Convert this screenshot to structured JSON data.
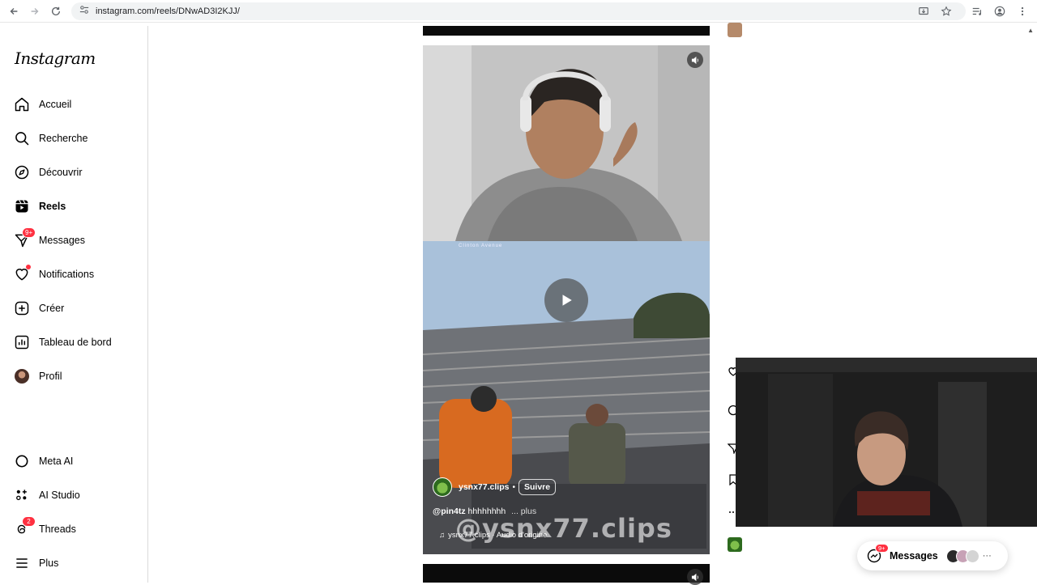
{
  "browser": {
    "url": "instagram.com/reels/DNwAD3I2KJJ/"
  },
  "sidebar": {
    "logo": "Instagram",
    "items": [
      {
        "label": "Accueil",
        "icon": "home-icon"
      },
      {
        "label": "Recherche",
        "icon": "search-icon"
      },
      {
        "label": "Découvrir",
        "icon": "compass-icon"
      },
      {
        "label": "Reels",
        "icon": "reels-icon",
        "active": true
      },
      {
        "label": "Messages",
        "icon": "messenger-icon",
        "badge": "9+"
      },
      {
        "label": "Notifications",
        "icon": "heart-icon",
        "dot": true
      },
      {
        "label": "Créer",
        "icon": "plus-square-icon"
      },
      {
        "label": "Tableau de bord",
        "icon": "dashboard-icon"
      },
      {
        "label": "Profil",
        "icon": "avatar"
      }
    ],
    "bottom_items": [
      {
        "label": "Meta AI",
        "icon": "meta-ai-icon"
      },
      {
        "label": "AI Studio",
        "icon": "ai-studio-icon"
      },
      {
        "label": "Threads",
        "icon": "threads-icon",
        "badge": "2"
      },
      {
        "label": "Plus",
        "icon": "menu-icon"
      }
    ]
  },
  "reel": {
    "top_text": "Clinton Avenue",
    "username": "ysnx77.clips",
    "separator": "•",
    "follow_label": "Suivre",
    "caption_user": "@pin4tz",
    "caption_text": "hhhhhhhh",
    "caption_more": "... plus",
    "audio": "ysnx77.clips · Audio d'origine",
    "watermark": "@ysnx77.clips"
  },
  "messages_pill": {
    "label": "Messages",
    "badge": "9+",
    "more": "···"
  },
  "colors": {
    "badge_red": "#ff3040",
    "sidebar_border": "#dbdbdb"
  }
}
